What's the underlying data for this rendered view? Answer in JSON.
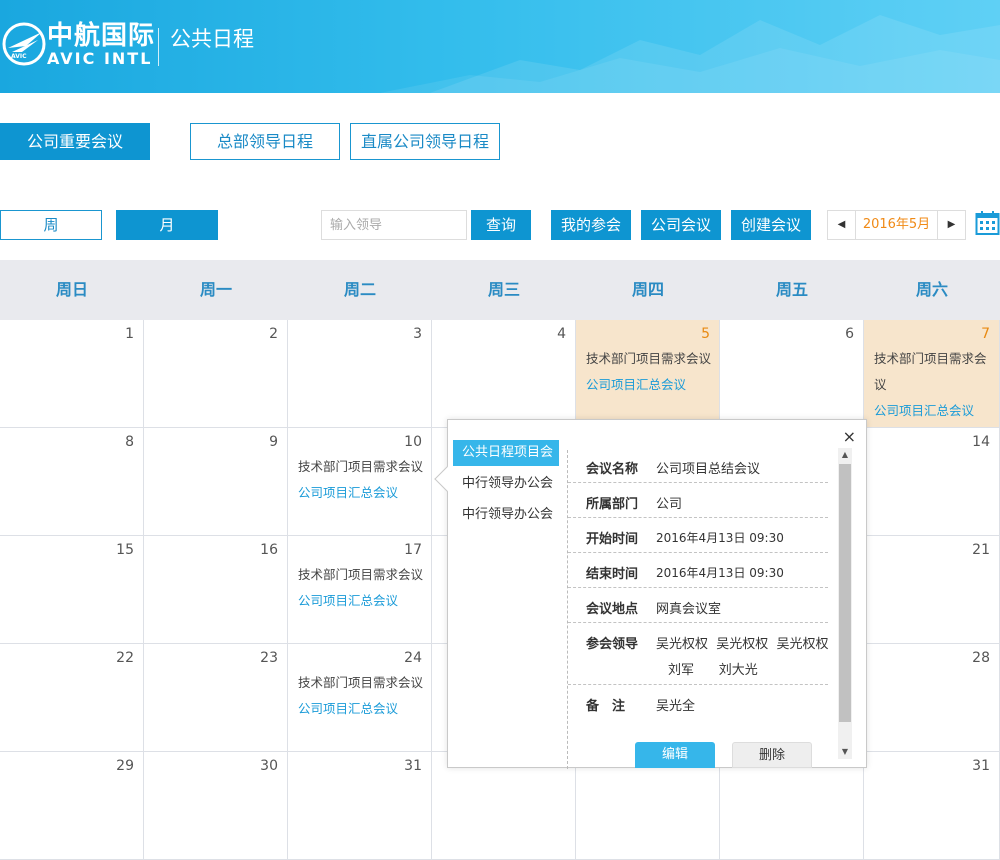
{
  "header": {
    "brand_cn": "中航国际",
    "brand_en": "AVIC  INTL",
    "logo_mark": "AVIC",
    "title": "公共日程"
  },
  "top_tabs": [
    {
      "label": "公司重要会议",
      "active": true
    },
    {
      "label": "总部领导日程",
      "active": false
    },
    {
      "label": "直属公司领导日程",
      "active": false
    }
  ],
  "toolbar": {
    "view_week": "周",
    "view_month": "月",
    "search_placeholder": "输入领导",
    "query_label": "查询",
    "my_meetings_label": "我的参会",
    "company_meetings_label": "公司会议",
    "create_meeting_label": "创建会议",
    "current_month": "2016年5月",
    "prev_icon": "triangle-left-icon",
    "next_icon": "triangle-right-icon",
    "calendar_icon": "calendar-icon"
  },
  "colors": {
    "accent": "#0e95d1",
    "highlight": "#f7e5cc",
    "date_highlight": "#e88a12",
    "link": "#1a9bd8"
  },
  "weekdays": [
    "周日",
    "周一",
    "周二",
    "周三",
    "周四",
    "周五",
    "周六"
  ],
  "weeks": [
    [
      {
        "day": "1"
      },
      {
        "day": "2"
      },
      {
        "day": "3"
      },
      {
        "day": "4"
      },
      {
        "day": "5",
        "highlight": true,
        "events": [
          "技术部门项目需求会议",
          "公司项目汇总会议"
        ]
      },
      {
        "day": "6"
      },
      {
        "day": "7",
        "highlight": true,
        "events": [
          "技术部门项目需求会议",
          "公司项目汇总会议"
        ]
      }
    ],
    [
      {
        "day": "8"
      },
      {
        "day": "9"
      },
      {
        "day": "10",
        "events": [
          "技术部门项目需求会议",
          "公司项目汇总会议"
        ]
      },
      {
        "day": ""
      },
      {
        "day": ""
      },
      {
        "day": ""
      },
      {
        "day": "14"
      }
    ],
    [
      {
        "day": "15"
      },
      {
        "day": "16"
      },
      {
        "day": "17",
        "events": [
          "技术部门项目需求会议",
          "公司项目汇总会议"
        ]
      },
      {
        "day": ""
      },
      {
        "day": ""
      },
      {
        "day": ""
      },
      {
        "day": "21"
      }
    ],
    [
      {
        "day": "22"
      },
      {
        "day": "23"
      },
      {
        "day": "24",
        "events": [
          "技术部门项目需求会议",
          "公司项目汇总会议"
        ]
      },
      {
        "day": ""
      },
      {
        "day": ""
      },
      {
        "day": ""
      },
      {
        "day": "28"
      }
    ],
    [
      {
        "day": "29"
      },
      {
        "day": "30"
      },
      {
        "day": "31"
      },
      {
        "day": ""
      },
      {
        "day": ""
      },
      {
        "day": ""
      },
      {
        "day": "31"
      }
    ]
  ],
  "popup": {
    "close_icon": "×",
    "list": [
      {
        "label": "公共日程项目会",
        "active": true
      },
      {
        "label": "中行领导办公会",
        "active": false
      },
      {
        "label": "中行领导办公会",
        "active": false
      }
    ],
    "details": [
      {
        "key": "会议名称",
        "value": "公司项目总结会议"
      },
      {
        "key": "所属部门",
        "value": "公司"
      },
      {
        "key": "开始时间",
        "value": "2016年4月13日  09:30"
      },
      {
        "key": "结束时间",
        "value": "2016年4月13日  09:30"
      },
      {
        "key": "会议地点",
        "value": "网真会议室"
      },
      {
        "key": "参会领导",
        "value": "吴光权权  吴光权权  吴光权权",
        "value2": "刘军      刘大光"
      },
      {
        "key": "备　注",
        "value": "吴光全"
      }
    ],
    "edit_label": "编辑",
    "delete_label": "删除"
  }
}
